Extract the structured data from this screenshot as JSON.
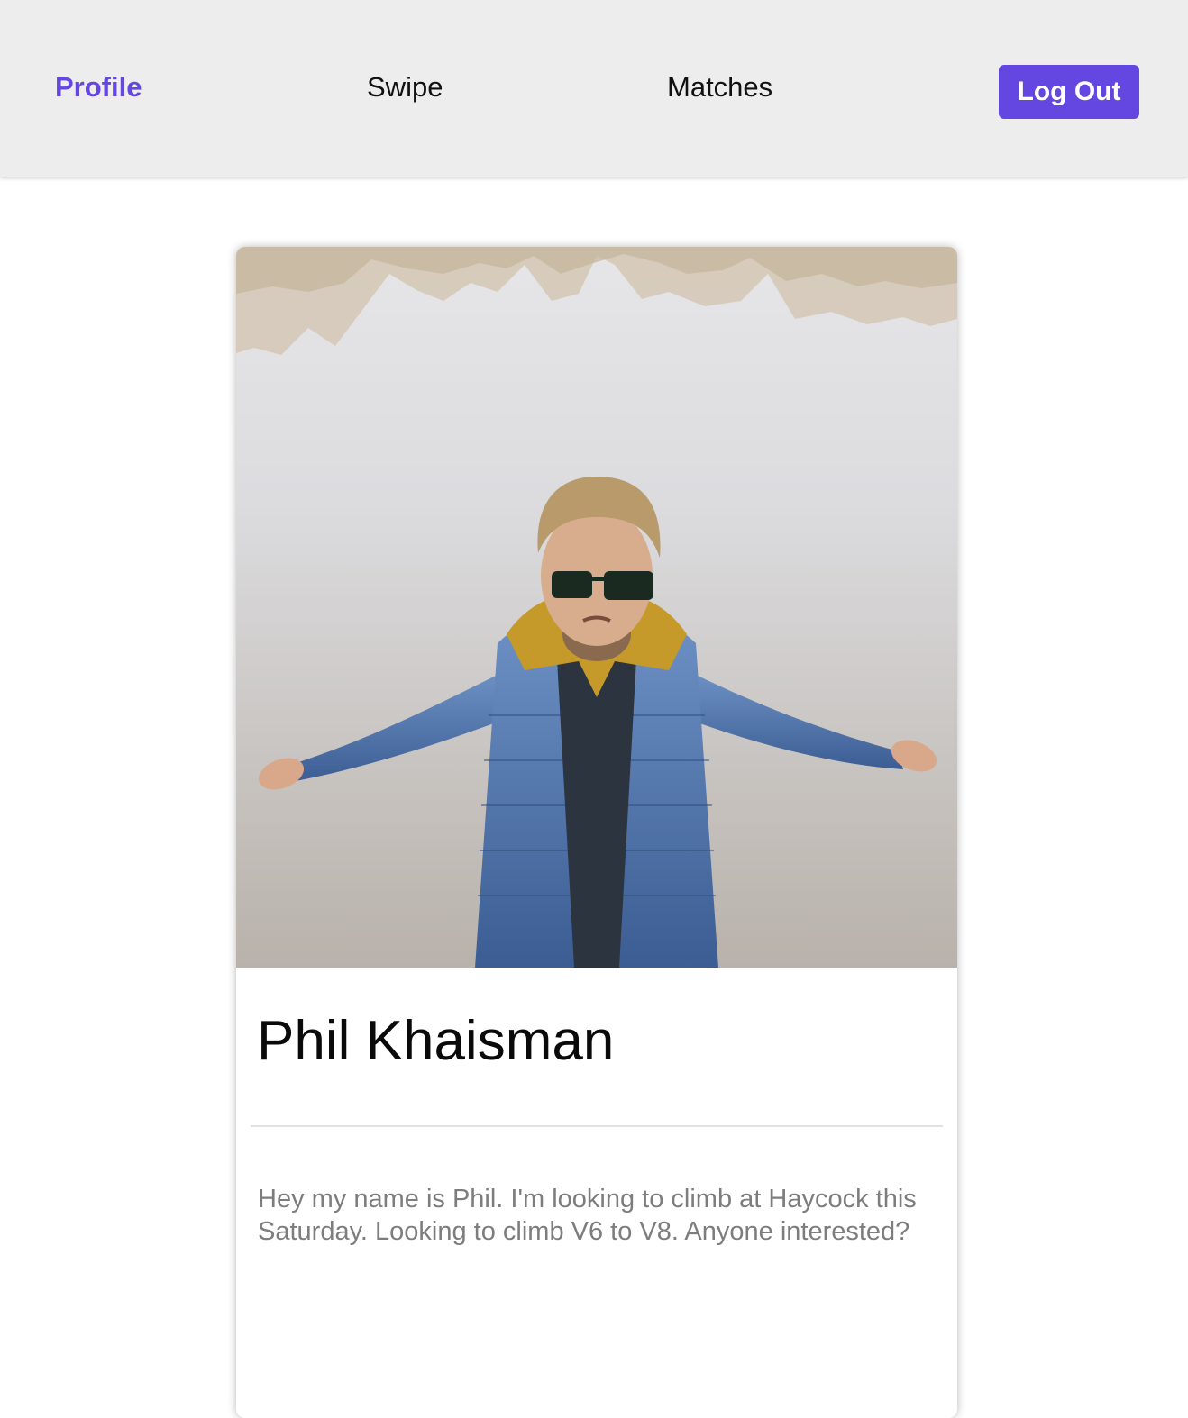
{
  "nav": {
    "profile_label": "Profile",
    "swipe_label": "Swipe",
    "matches_label": "Matches",
    "logout_label": "Log Out",
    "active_item": "Profile"
  },
  "profile": {
    "name": "Phil Khaisman",
    "bio": "Hey my name is Phil. I'm looking to climb at Haycock this Saturday. Looking to climb V6 to V8. Anyone interested?",
    "photo_description": "climber-in-blue-jacket-portrait"
  },
  "colors": {
    "accent": "#6446e0",
    "navbar_bg": "#ededed",
    "bio_text": "#7d7d7d"
  }
}
